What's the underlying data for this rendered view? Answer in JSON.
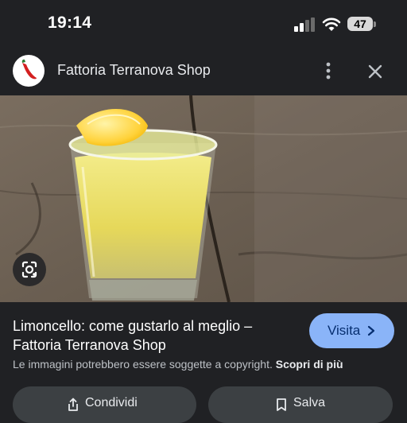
{
  "status_bar": {
    "time": "19:14",
    "battery": "47",
    "icons": [
      "signal-icon",
      "wifi-icon",
      "battery-icon"
    ]
  },
  "site": {
    "name": "Fattoria Terranova Shop",
    "logo_icon": "chili-pepper-logo",
    "more_icon": "more-vert-icon",
    "close_icon": "close-icon"
  },
  "image": {
    "description_icon": "lens-icon"
  },
  "result": {
    "title": "Limoncello: come gustarlo al meglio – Fattoria Terranova Shop",
    "visit_label": "Visita",
    "copyright_text": "Le immagini potrebbero essere soggette a copyright.",
    "learn_more": "Scopri di più"
  },
  "actions": {
    "share_label": "Condividi",
    "save_label": "Salva"
  },
  "colors": {
    "background": "#202124",
    "accent": "#8ab4f8",
    "action_bg": "#3c4043"
  }
}
